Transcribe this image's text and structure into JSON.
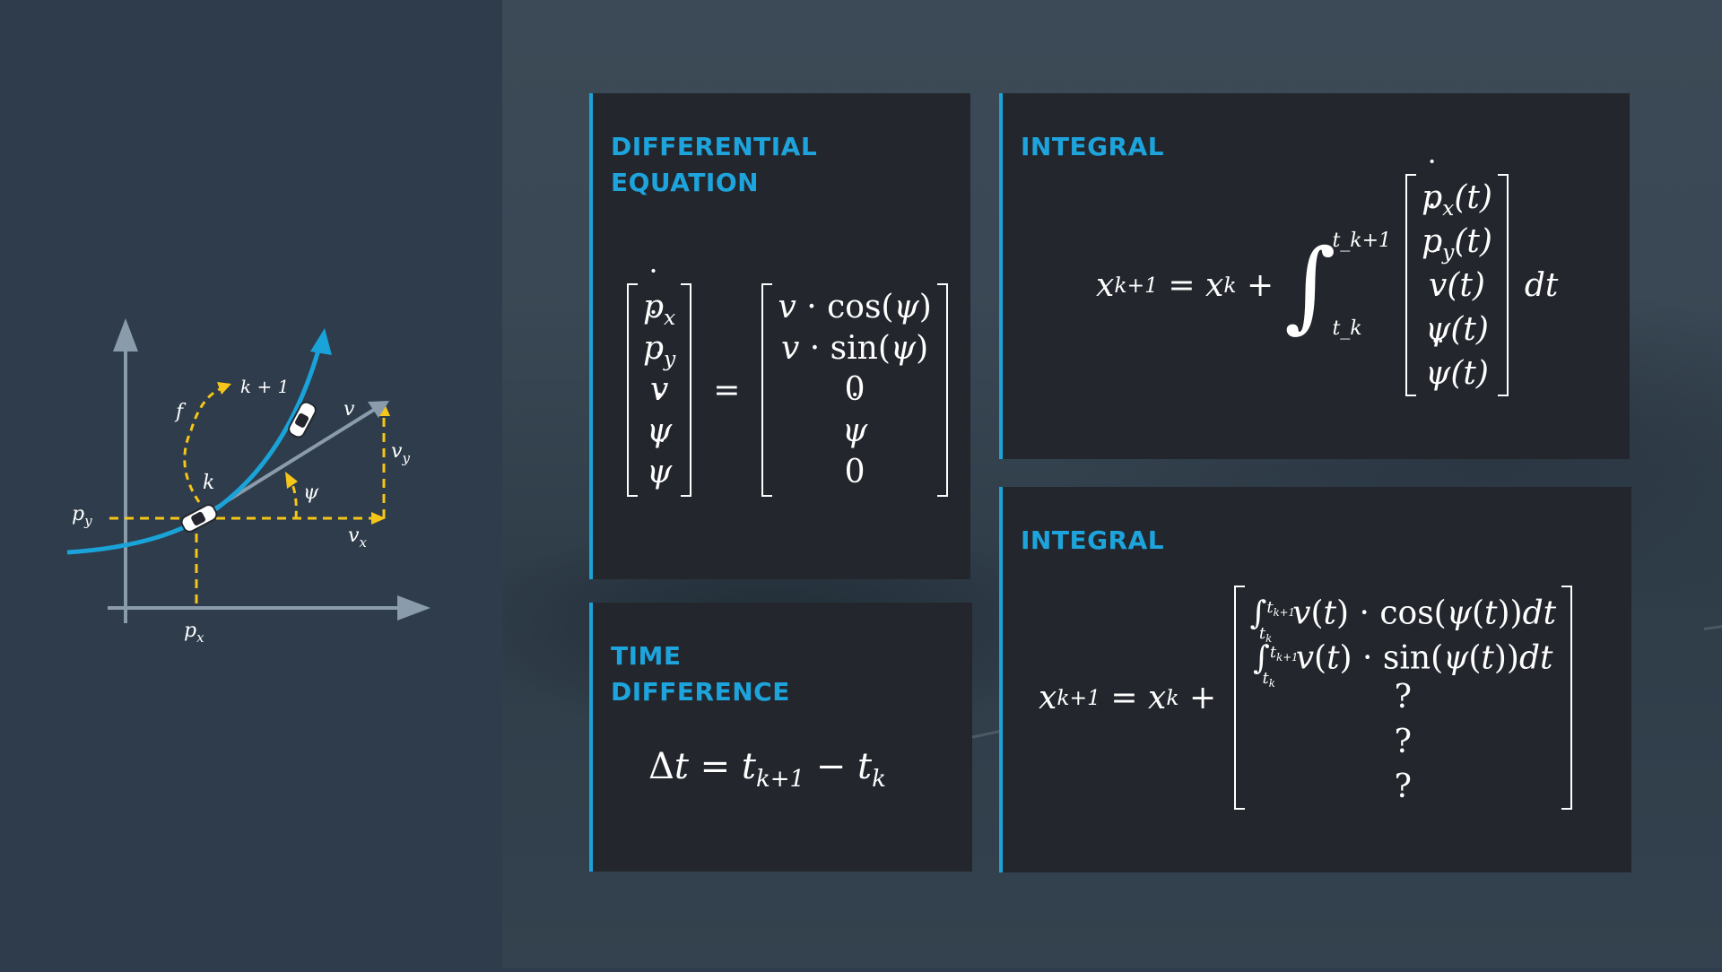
{
  "colors": {
    "accent": "#1ea4dc",
    "path": "#1aa3d9",
    "guide": "#f5c518",
    "axis": "#8a9bab",
    "panel": "#23272d"
  },
  "diagram": {
    "labels": {
      "py": "p_y",
      "px": "p_x",
      "k": "k",
      "k1": "k + 1",
      "f": "f",
      "v": "v",
      "vx": "v_x",
      "vy": "v_y",
      "psi": "ψ"
    }
  },
  "panels": {
    "differential": {
      "title": "DIFFERENTIAL\nEQUATION",
      "lhs": [
        "p_x",
        "p_y",
        "v",
        "ψ",
        "ψ"
      ],
      "rhs": [
        "v · cos(ψ)",
        "v · sin(ψ)",
        "0",
        "ψ",
        "0"
      ]
    },
    "time_difference": {
      "title": "TIME\nDIFFERENCE",
      "equation": "Δt = t_k+1 − t_k"
    },
    "integral_top": {
      "title": "INTEGRAL",
      "lhs": "x_k+1 = x_k +",
      "lower": "t_k",
      "upper": "t_k+1",
      "vector": [
        "p_x(t)",
        "p_y(t)",
        "v(t)",
        "ψ(t)",
        "ψ(t)"
      ],
      "dt": "dt"
    },
    "integral_bottom": {
      "title": "INTEGRAL",
      "lhs": "x_k+1 = x_k +",
      "rows": [
        "v(t) · cos(ψ(t))dt",
        "v(t) · sin(ψ(t))dt",
        "?",
        "?",
        "?"
      ]
    }
  }
}
